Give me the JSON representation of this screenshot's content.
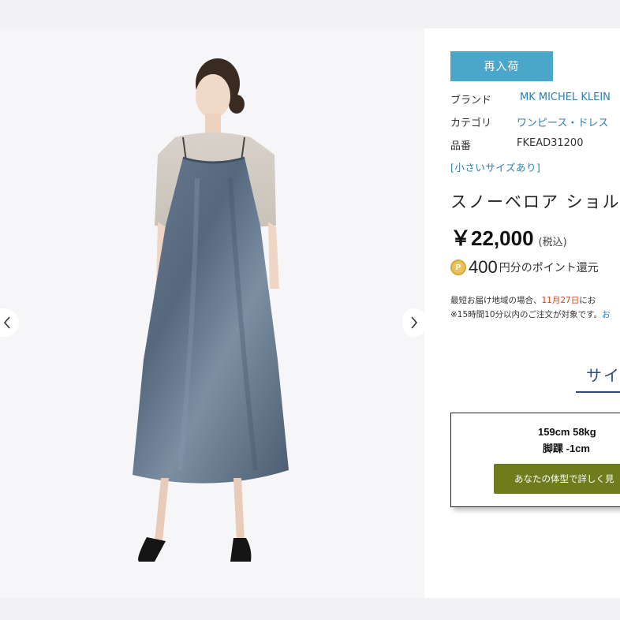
{
  "product": {
    "restock_label": "再入荷",
    "meta": [
      {
        "label": "ブランド",
        "value": "MK MICHEL KLEIN"
      },
      {
        "label": "カテゴリ",
        "value": "ワンピース・ドレス"
      },
      {
        "label": "品番",
        "value": "FKEAD31200"
      }
    ],
    "size_note": "[小さいサイズあり]",
    "title": "スノーベロア ショル",
    "price": "￥22,000",
    "tax_note": "(税込)",
    "points_icon": "P",
    "points_value": "400",
    "points_text": "円分のポイント還元",
    "delivery_line1_a": "最短お届け地域の場合、",
    "delivery_date": "11月27日",
    "delivery_line1_b": "にお",
    "delivery_line2_a": "※15時間10分以内のご注文が対象です。",
    "delivery_line2_link": "お"
  },
  "size_section": {
    "heading": "サイ",
    "fit_line1": "159cm 58kg",
    "fit_line2": "脚踝  -1cm",
    "fit_button": "あなたの体型で詳しく見"
  },
  "icons": {
    "prev": "chevron-left-icon",
    "next": "chevron-right-icon",
    "points": "point-coin-icon"
  },
  "colors": {
    "restock": "#4aa6cb",
    "link": "#2d7fb0",
    "accent_red": "#d0451b",
    "heading_navy": "#2f4d7a",
    "fit_button": "#6f7c1c",
    "dress": "#5d6e83"
  }
}
